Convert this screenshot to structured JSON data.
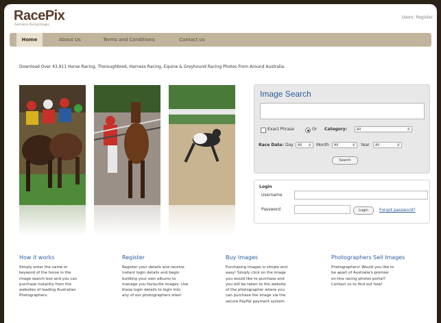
{
  "header": {
    "logo": "RacePix",
    "logo_tagline": "Australian Racing Images",
    "links": "Users: Register"
  },
  "nav": {
    "items": [
      {
        "label": "Home",
        "active": true
      },
      {
        "label": "About Us",
        "active": false
      },
      {
        "label": "Terms and Conditions",
        "active": false
      },
      {
        "label": "Contact us",
        "active": false
      }
    ]
  },
  "intro": "Download Over 43,911 Horse Racing, Thoroughbred, Harness Racing, Equine & Greyhound Racing Photos From Around Australia.",
  "search": {
    "title": "Image Search",
    "query": "",
    "exact_phrase_label": "Exact Phrase",
    "or_label": "Or",
    "category_label": "Category:",
    "category_value": "All",
    "race_date_label": "Race Date:",
    "day_label": "Day",
    "day_value": "All",
    "month_label": "Month",
    "month_value": "All",
    "year_label": "Year",
    "year_value": "All",
    "button_label": "Search"
  },
  "login": {
    "title": "Login",
    "username_label": "Username",
    "password_label": "Password",
    "button_label": "Login",
    "forgot_label": "Forgot password?"
  },
  "columns": [
    {
      "title": "How it works",
      "lines": [
        "Simply enter the name or",
        "keyword of the horse in the",
        "image search box and you can",
        "purchase instantly from the",
        "websites of leading Australian",
        "Photographers."
      ]
    },
    {
      "title": "Register",
      "lines": [
        "Register your details and receive",
        "instant login details and begin",
        "building your own albums to",
        "manage you favourite images. Use",
        "these login details to login into",
        "any of our photographers sites!"
      ]
    },
    {
      "title": "Buy Images",
      "lines": [
        "Purchasing images is simple and",
        "easy! Simply click on the image",
        "you would like to purchase and",
        "you will be taken to the website",
        "of the photographer where you",
        "can purchase the image via the",
        "secure PayPal payment system."
      ]
    },
    {
      "title": "Photographers Sell Images",
      "lines": [
        "Photographers! Would you like to",
        "be apart of Australia's premier",
        "on-line racing photos portal?",
        "Contact us to find out how!"
      ]
    }
  ]
}
